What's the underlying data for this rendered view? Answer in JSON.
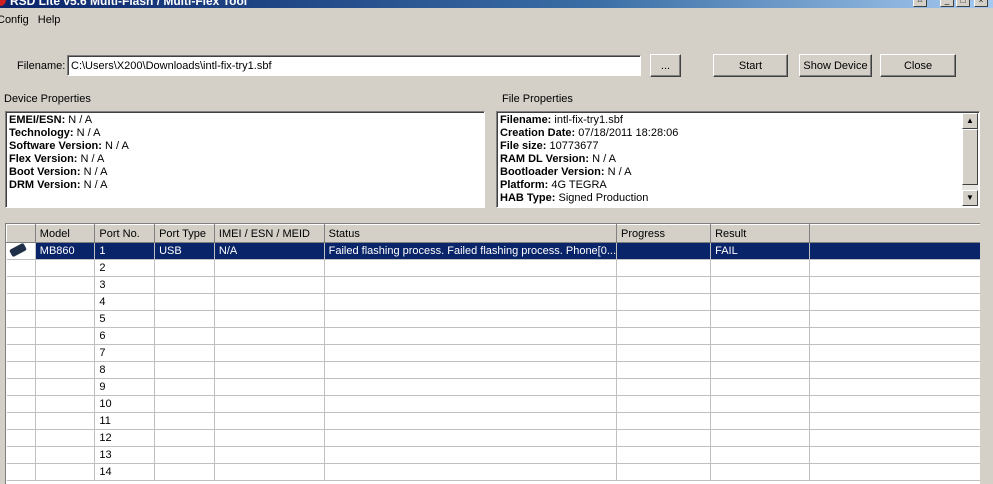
{
  "window": {
    "title": "RSD Lite v5.6 Multi-Flash / Multi-Flex Tool",
    "minimize_glyph": "_",
    "maximize_glyph": "□",
    "close_glyph": "×",
    "resize_glyph": "⇔"
  },
  "menu": [
    "Config",
    "Help"
  ],
  "filename": {
    "label": "Filename:",
    "value": "C:\\Users\\X200\\Downloads\\intl-fix-try1.sbf",
    "browse_label": "..."
  },
  "buttons": {
    "start": "Start",
    "show_device": "Show Device",
    "close": "Close"
  },
  "device_properties": {
    "title": "Device Properties",
    "rows": [
      {
        "key": "EMEI/ESN:",
        "value": " N / A"
      },
      {
        "key": "Technology:",
        "value": " N / A"
      },
      {
        "key": "Software Version:",
        "value": " N / A"
      },
      {
        "key": "Flex Version:",
        "value": " N / A"
      },
      {
        "key": "Boot Version:",
        "value": " N / A"
      },
      {
        "key": "DRM Version:",
        "value": " N / A"
      }
    ]
  },
  "file_properties": {
    "title": "File Properties",
    "rows": [
      {
        "key": "Filename:",
        "value": " intl-fix-try1.sbf"
      },
      {
        "key": "Creation Date:",
        "value": " 07/18/2011 18:28:06"
      },
      {
        "key": "File size:",
        "value": " 10773677"
      },
      {
        "key": "RAM DL Version:",
        "value": " N / A"
      },
      {
        "key": "Bootloader Version:",
        "value": " N / A"
      },
      {
        "key": "Platform:",
        "value": " 4G TEGRA"
      },
      {
        "key": "HAB Type:",
        "value": " Signed Production"
      }
    ],
    "scroll_up": "▲",
    "scroll_down": "▼"
  },
  "table": {
    "columns": [
      "",
      "Model",
      "Port No.",
      "Port Type",
      "IMEI / ESN / MEID",
      "Status",
      "Progress",
      "Result",
      ""
    ],
    "rows": [
      {
        "model": "MB860",
        "port": "1",
        "type": "USB",
        "imei": "N/A",
        "status": "Failed flashing process. Failed flashing process. Phone[0...",
        "progress": "",
        "result": "FAIL",
        "selected": true
      },
      {
        "model": "",
        "port": "2",
        "type": "",
        "imei": "",
        "status": "",
        "progress": "",
        "result": ""
      },
      {
        "model": "",
        "port": "3",
        "type": "",
        "imei": "",
        "status": "",
        "progress": "",
        "result": ""
      },
      {
        "model": "",
        "port": "4",
        "type": "",
        "imei": "",
        "status": "",
        "progress": "",
        "result": ""
      },
      {
        "model": "",
        "port": "5",
        "type": "",
        "imei": "",
        "status": "",
        "progress": "",
        "result": ""
      },
      {
        "model": "",
        "port": "6",
        "type": "",
        "imei": "",
        "status": "",
        "progress": "",
        "result": ""
      },
      {
        "model": "",
        "port": "7",
        "type": "",
        "imei": "",
        "status": "",
        "progress": "",
        "result": ""
      },
      {
        "model": "",
        "port": "8",
        "type": "",
        "imei": "",
        "status": "",
        "progress": "",
        "result": ""
      },
      {
        "model": "",
        "port": "9",
        "type": "",
        "imei": "",
        "status": "",
        "progress": "",
        "result": ""
      },
      {
        "model": "",
        "port": "10",
        "type": "",
        "imei": "",
        "status": "",
        "progress": "",
        "result": ""
      },
      {
        "model": "",
        "port": "11",
        "type": "",
        "imei": "",
        "status": "",
        "progress": "",
        "result": ""
      },
      {
        "model": "",
        "port": "12",
        "type": "",
        "imei": "",
        "status": "",
        "progress": "",
        "result": ""
      },
      {
        "model": "",
        "port": "13",
        "type": "",
        "imei": "",
        "status": "",
        "progress": "",
        "result": ""
      },
      {
        "model": "",
        "port": "14",
        "type": "",
        "imei": "",
        "status": "",
        "progress": "",
        "result": ""
      }
    ]
  },
  "colors": {
    "selection": "#0a246a",
    "face": "#d4d0c8",
    "title_start": "#0a246a",
    "title_end": "#a6caf0"
  },
  "icons": {
    "app": "app-logo-icon",
    "device": "phone-icon"
  }
}
